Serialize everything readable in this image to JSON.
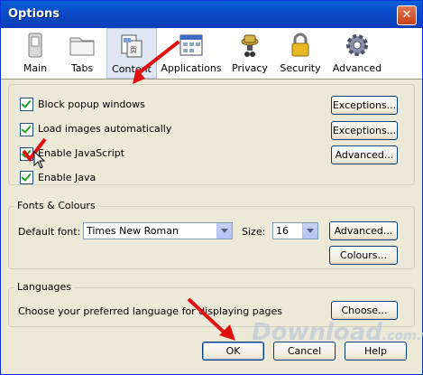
{
  "window": {
    "title": "Options",
    "close_glyph": "✕"
  },
  "toolbar": {
    "items": [
      {
        "label": "Main",
        "icon": "switch-icon"
      },
      {
        "label": "Tabs",
        "icon": "folder-icon"
      },
      {
        "label": "Content",
        "icon": "content-page-icon",
        "selected": true
      },
      {
        "label": "Applications",
        "icon": "applications-window-icon"
      },
      {
        "label": "Privacy",
        "icon": "privacy-mask-icon"
      },
      {
        "label": "Security",
        "icon": "lock-icon"
      },
      {
        "label": "Advanced",
        "icon": "gear-icon"
      }
    ]
  },
  "content": {
    "block_popups": {
      "label": "Block popup windows",
      "checked": true
    },
    "load_images": {
      "label": "Load images automatically",
      "checked": true
    },
    "enable_js": {
      "label": "Enable JavaScript",
      "checked": true
    },
    "enable_java": {
      "label": "Enable Java",
      "checked": true
    },
    "exceptions1": "Exceptions...",
    "exceptions2": "Exceptions...",
    "advanced": "Advanced..."
  },
  "fonts": {
    "title": "Fonts & Colours",
    "default_font_label": "Default font:",
    "default_font_value": "Times New Roman",
    "size_label": "Size:",
    "size_value": "16",
    "advanced": "Advanced...",
    "colours": "Colours..."
  },
  "languages": {
    "title": "Languages",
    "description": "Choose your preferred language for displaying pages",
    "choose": "Choose..."
  },
  "footer": {
    "ok": "OK",
    "cancel": "Cancel",
    "help": "Help"
  },
  "watermark": {
    "text": "Download",
    "suffix": ".com.vn"
  },
  "colors": {
    "title_bar": "#0a5fd8",
    "annotation_red": "#e01010",
    "check_green": "#21a121"
  }
}
